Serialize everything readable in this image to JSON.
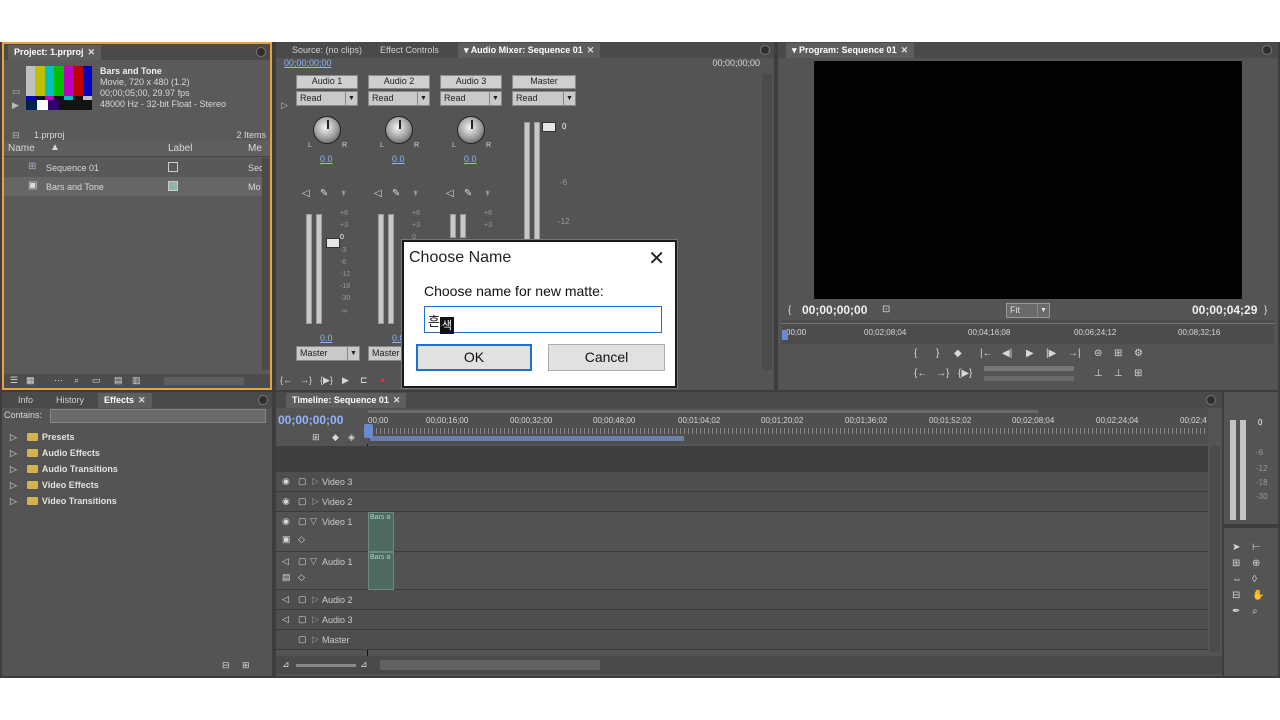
{
  "project": {
    "tab_label": "Project: 1.prproj",
    "clip_title": "Bars and Tone",
    "clip_info1": "Movie, 720 x 480 (1.2)",
    "clip_info2": "00;00;05;00, 29.97 fps",
    "clip_info3": "48000 Hz - 32-bit Float - Stereo",
    "file_name": "1.prproj",
    "item_count": "2 Items",
    "col_name": "Name",
    "col_label": "Label",
    "col_media": "Me",
    "rows": [
      {
        "name": "Sequence 01",
        "media": "Sec"
      },
      {
        "name": "Bars and Tone",
        "media": "Mo"
      }
    ]
  },
  "effects": {
    "tabs": [
      "Info",
      "History",
      "Effects"
    ],
    "contains_label": "Contains:",
    "items": [
      "Presets",
      "Audio Effects",
      "Audio Transitions",
      "Video Effects",
      "Video Transitions"
    ]
  },
  "mixer": {
    "tabs": [
      "Source: (no clips)",
      "Effect Controls",
      "Audio Mixer: Sequence 01"
    ],
    "timecode_left": "00;00;00;00",
    "timecode_right": "00;00;00;00",
    "channels": [
      {
        "name": "Audio 1",
        "mode": "Read",
        "pan": "0.0",
        "vol": "0.0",
        "out": "Master"
      },
      {
        "name": "Audio 2",
        "mode": "Read",
        "pan": "0.0",
        "vol": "0.0",
        "out": "Master"
      },
      {
        "name": "Audio 3",
        "mode": "Read",
        "pan": "0.0"
      }
    ],
    "master": {
      "name": "Master",
      "mode": "Read"
    },
    "scale": [
      "+6",
      "+3",
      "0",
      "-3",
      "-6",
      "-12",
      "-18",
      "-30",
      "-∞"
    ],
    "master_scale": [
      "0",
      "-6",
      "-12"
    ]
  },
  "program": {
    "tab_label": "Program: Sequence 01",
    "timecode": "00;00;00;00",
    "duration": "00;00;04;29",
    "zoom": "Fit",
    "ruler": [
      "00;00",
      "00;02;08;04",
      "00;04;16;08",
      "00;06;24;12",
      "00;08;32;16"
    ]
  },
  "timeline": {
    "tab_label": "Timeline: Sequence 01",
    "timecode": "00;00;00;00",
    "ruler": [
      "00;00",
      "00;00;16;00",
      "00;00;32;00",
      "00;00;48;00",
      "00;01;04;02",
      "00;01;20;02",
      "00;01;36;02",
      "00;01;52;02",
      "00;02;08;04",
      "00;02;24;04",
      "00;02;4"
    ],
    "tracks": [
      "Video 3",
      "Video 2",
      "Video 1",
      "Audio 1",
      "Audio 2",
      "Audio 3",
      "Master"
    ],
    "clip_label": "Bars a"
  },
  "meter": {
    "scale": [
      "0",
      "-6",
      "-12",
      "-18",
      "-30"
    ]
  },
  "dialog": {
    "title": "Choose Name",
    "prompt": "Choose name for new matte:",
    "input_prefix": "흔",
    "input_ime": "색",
    "ok_label": "OK",
    "cancel_label": "Cancel"
  },
  "colors": {
    "accent_orange": "#e8a33c",
    "dialog_focus": "#1f6fd0",
    "panel_bg": "#545454",
    "timecode_blue": "#8fb6ff"
  }
}
